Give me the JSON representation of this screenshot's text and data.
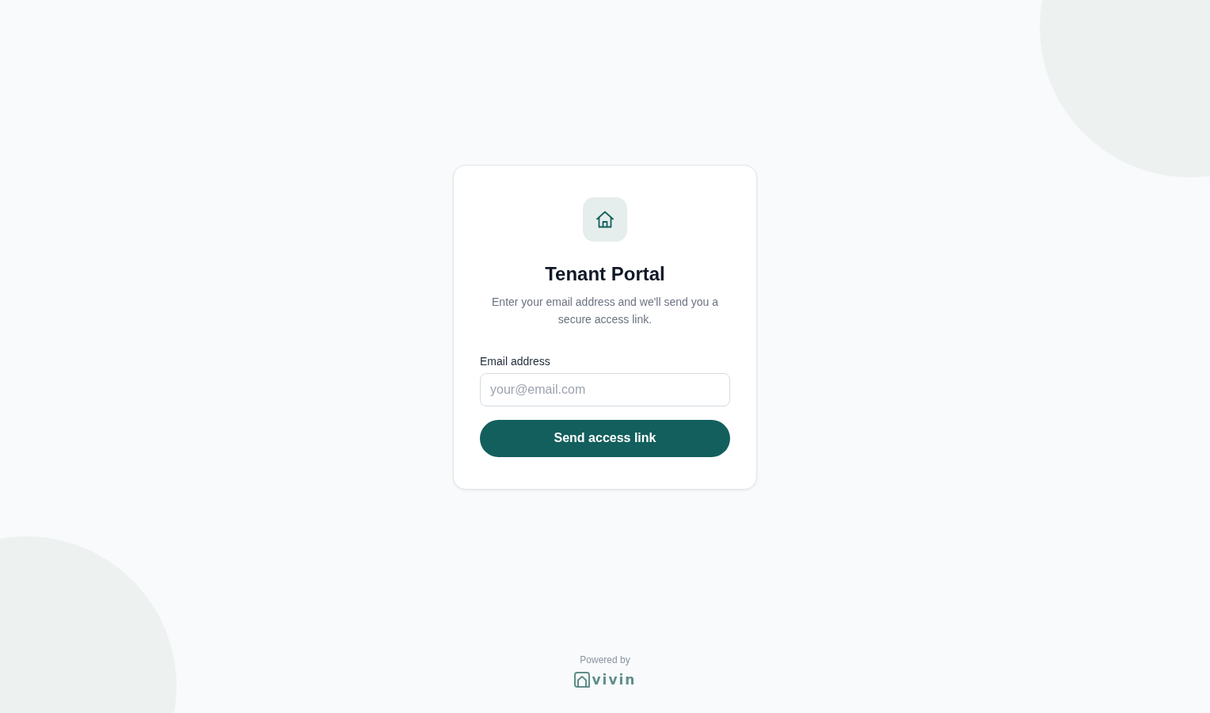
{
  "card": {
    "title": "Tenant Portal",
    "subtitle": "Enter your email address and we'll send you a secure access link.",
    "email_field": {
      "label": "Email address",
      "placeholder": "your@email.com"
    },
    "submit_button": "Send access link"
  },
  "footer": {
    "powered_by": "Powered by",
    "brand": "vivin"
  }
}
